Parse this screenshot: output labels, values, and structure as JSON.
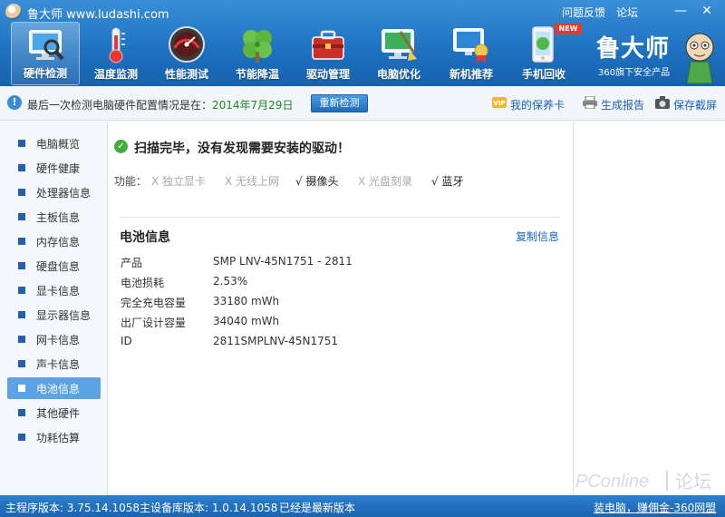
{
  "app": {
    "title": "鲁大师 www.ludashi.com",
    "feedback_link": "问题反馈",
    "forum_link": "论坛",
    "minimize_icon": "minimize-icon",
    "close_icon": "close-icon"
  },
  "nav": [
    {
      "label": "硬件检测",
      "icon": "monitor-magnifier-icon",
      "active": true
    },
    {
      "label": "温度监测",
      "icon": "thermometer-icon",
      "active": false
    },
    {
      "label": "性能测试",
      "icon": "speedometer-icon",
      "active": false
    },
    {
      "label": "节能降温",
      "icon": "clover-icon",
      "active": false
    },
    {
      "label": "驱动管理",
      "icon": "toolbox-icon",
      "active": false
    },
    {
      "label": "电脑优化",
      "icon": "monitor-broom-icon",
      "active": false
    },
    {
      "label": "新机推荐",
      "icon": "monitor-award-icon",
      "active": false
    },
    {
      "label": "手机回收",
      "icon": "phone-recycle-icon",
      "active": false
    }
  ],
  "new_badge": "NEW",
  "brand": {
    "name": "鲁大师",
    "subtitle": "360旗下安全产品"
  },
  "infobar": {
    "text": "最后一次检测电脑硬件配置情况是在：",
    "date": "2014年7月29日",
    "redetect_button": "重新检测",
    "warranty": "我的保养卡",
    "vip_badge": "VIP",
    "report": "生成报告",
    "screenshot": "保存截屏"
  },
  "sidebar": {
    "items": [
      {
        "label": "电脑概览"
      },
      {
        "label": "硬件健康"
      },
      {
        "label": "处理器信息"
      },
      {
        "label": "主板信息"
      },
      {
        "label": "内存信息"
      },
      {
        "label": "硬盘信息"
      },
      {
        "label": "显卡信息"
      },
      {
        "label": "显示器信息"
      },
      {
        "label": "网卡信息"
      },
      {
        "label": "声卡信息"
      },
      {
        "label": "电池信息"
      },
      {
        "label": "其他硬件"
      },
      {
        "label": "功耗估算"
      }
    ],
    "active_index": 10
  },
  "main": {
    "scan_status": "扫描完毕，没有发现需要安装的驱动！",
    "features_label": "功能：",
    "features": [
      {
        "text": "X  独立显卡",
        "available": false
      },
      {
        "text": "X  无线上网",
        "available": false
      },
      {
        "text": "√ 摄像头",
        "available": true
      },
      {
        "text": "X  光盘刻录",
        "available": false
      },
      {
        "text": "√ 蓝牙",
        "available": true
      }
    ],
    "section_title": "电池信息",
    "copy_link": "复制信息",
    "rows": [
      {
        "label": "产品",
        "value": "SMP LNV-45N1751 -   2811"
      },
      {
        "label": "电池损耗",
        "value": "2.53%"
      },
      {
        "label": "完全充电容量",
        "value": "33180 mWh"
      },
      {
        "label": "出厂设计容量",
        "value": "34040 mWh"
      },
      {
        "label": "ID",
        "value": "2811SMPLNV-45N1751"
      }
    ]
  },
  "statusbar": {
    "main_version": "主程序版本: 3.75.14.1058",
    "db_version": "主设备库版本: 1.0.14.1058",
    "latest": "已经是最新版本",
    "promo": "装电脑，赚佣金-360网盟"
  },
  "watermark": {
    "text": "PConline",
    "forum": "论坛"
  },
  "colors": {
    "header_blue": "#1f73c2",
    "sidebar_active": "#5ba3e5",
    "success_green": "#3fae3a",
    "date_green": "#1a8a1a",
    "link_blue": "#1a64c0"
  }
}
